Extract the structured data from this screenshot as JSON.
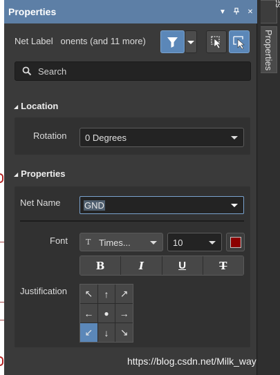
{
  "panel": {
    "title": "Properties",
    "title_icons": [
      "dropdown-icon",
      "pin-icon",
      "close-icon"
    ]
  },
  "filter": {
    "object_type": "Net Label",
    "selection_summary": "onents (and 11 more)"
  },
  "search": {
    "placeholder": "Search"
  },
  "location": {
    "heading": "Location",
    "rotation_label": "Rotation",
    "rotation_value": "0 Degrees"
  },
  "properties": {
    "heading": "Properties",
    "net_name_label": "Net Name",
    "net_name_value": "GND",
    "font_label": "Font",
    "font_family": "Times...",
    "font_size": "10",
    "font_color": "#8b0000",
    "style_buttons": [
      "B",
      "I",
      "U",
      "T"
    ],
    "justification_label": "Justification",
    "justification_glyphs": [
      "↖",
      "↑",
      "↗",
      "←",
      "●",
      "→",
      "↙",
      "↓",
      "↘"
    ],
    "justification_selected": 6
  },
  "side_tabs": {
    "top_label": "aries",
    "properties_label": "Properties"
  },
  "watermark": "https://blog.csdn.net/Milk_way",
  "colors": {
    "title_bar": "#5d7fa6",
    "active_button": "#5b87b8"
  }
}
